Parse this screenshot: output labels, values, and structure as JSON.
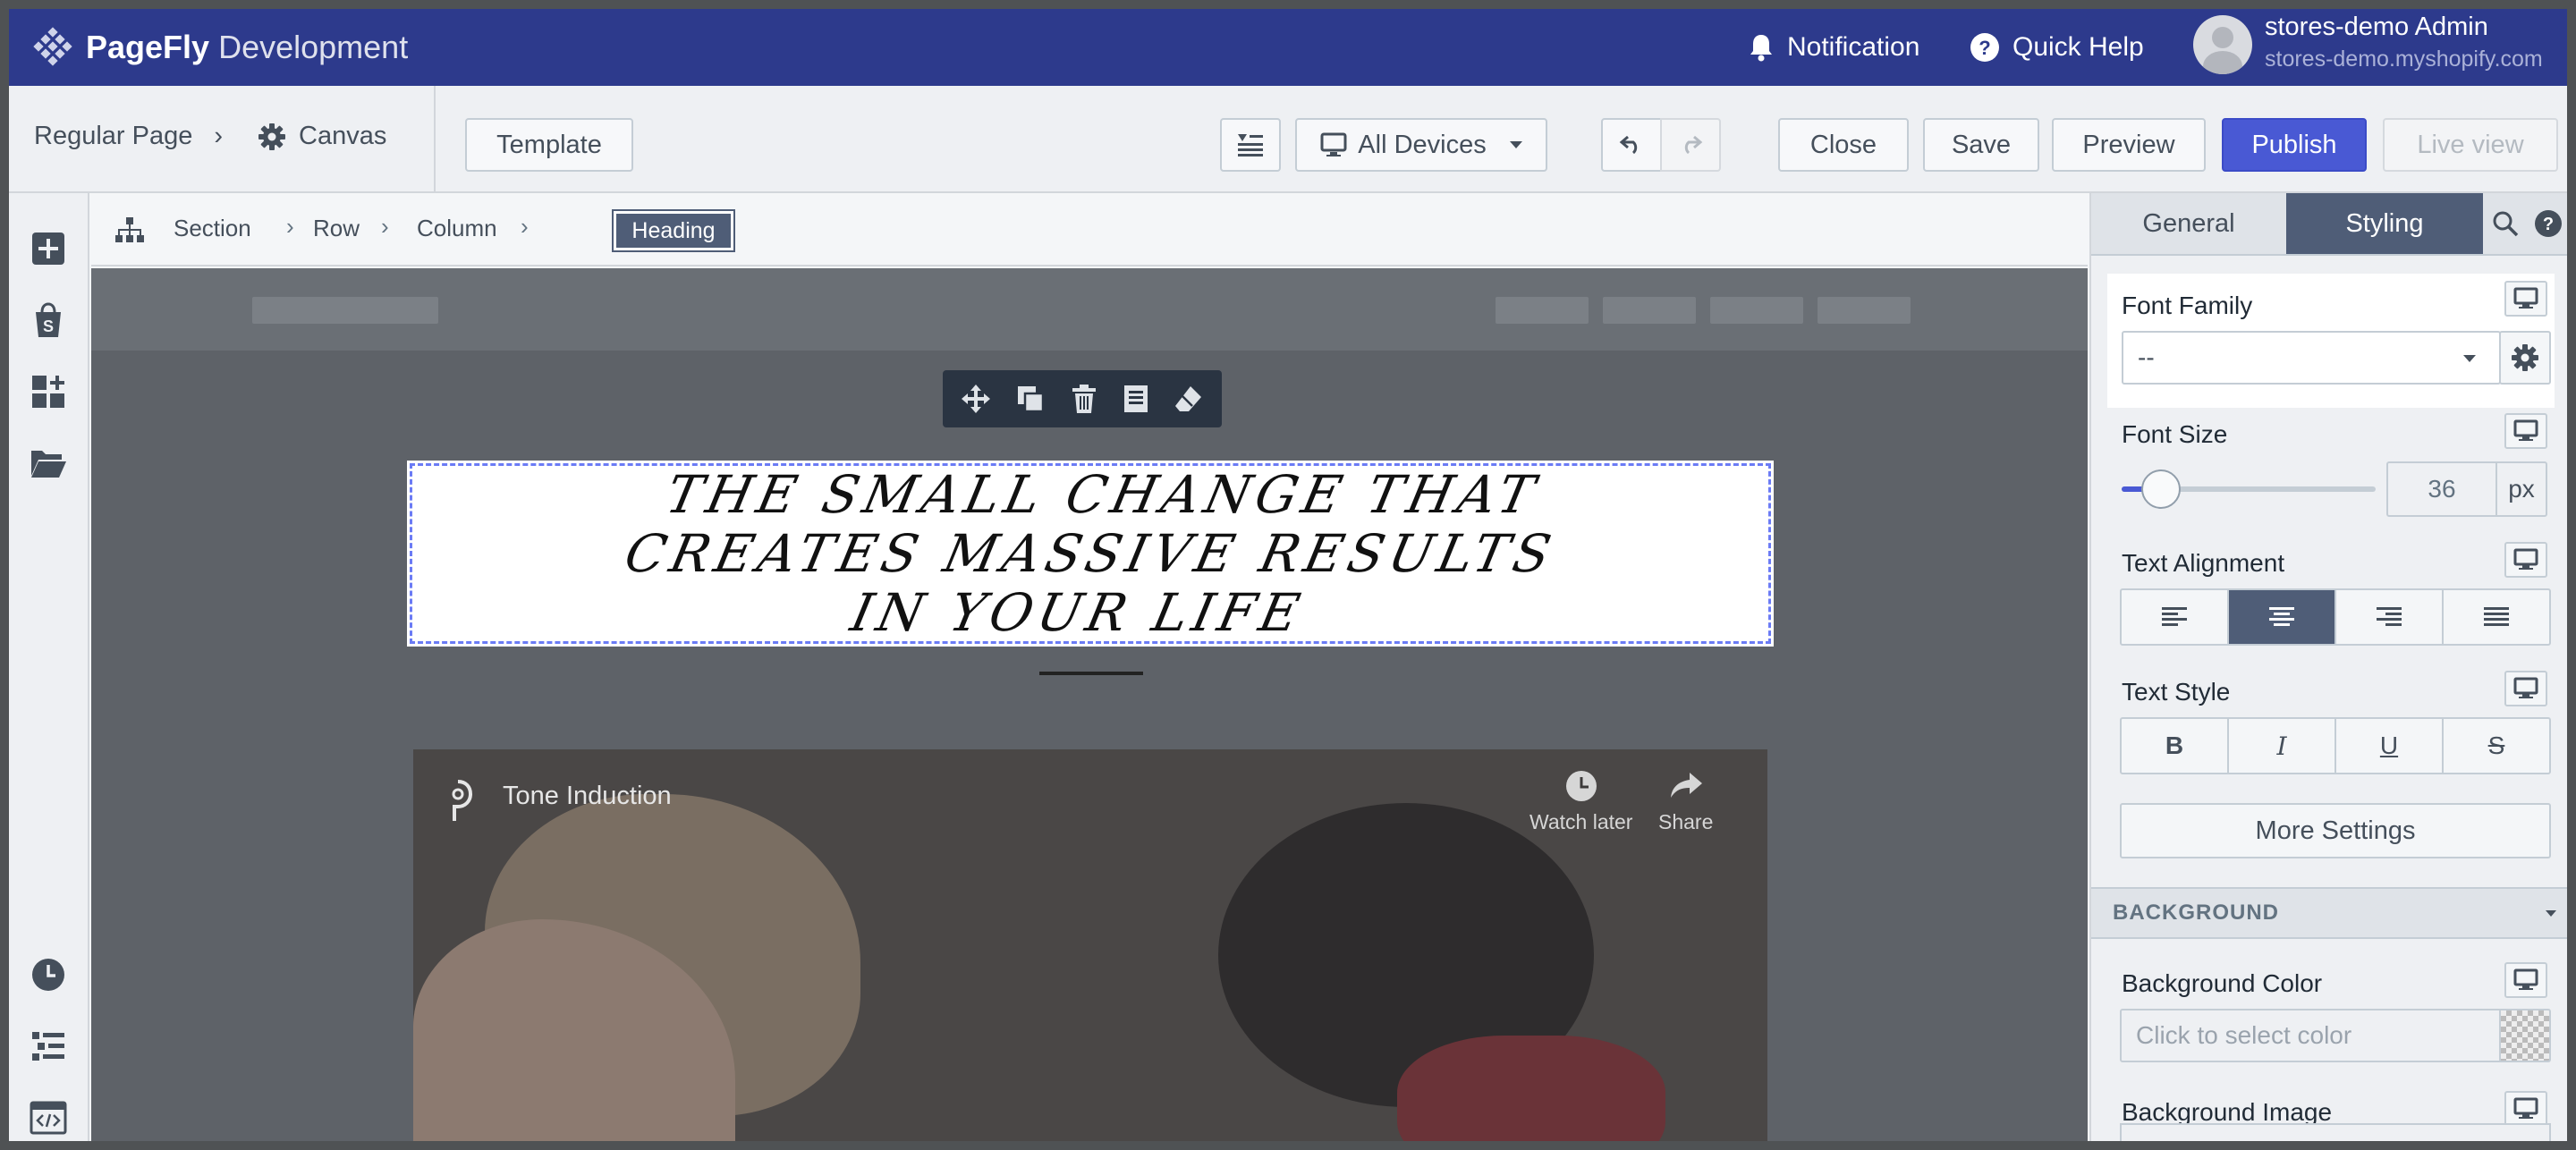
{
  "app": {
    "brand_bold": "PageFly",
    "brand_light": "Development",
    "notification": "Notification",
    "quick_help": "Quick Help",
    "user_name": "stores-demo Admin",
    "user_shop": "stores-demo.myshopify.com"
  },
  "toolbar": {
    "page_type": "Regular Page",
    "canvas": "Canvas",
    "template": "Template",
    "devices": "All Devices",
    "close": "Close",
    "save": "Save",
    "preview": "Preview",
    "publish": "Publish",
    "live_view": "Live view"
  },
  "breadcrumb": {
    "items": [
      "Section",
      "Row",
      "Column"
    ],
    "active": "Heading"
  },
  "canvas": {
    "heading_lines": [
      "THE SMALL CHANGE THAT",
      "CREATES MASSIVE RESULTS",
      "IN YOUR LIFE"
    ],
    "video": {
      "title": "Tone Induction",
      "watch_later": "Watch later",
      "share": "Share"
    }
  },
  "panel": {
    "tabs": [
      "General",
      "Styling"
    ],
    "active_tab": "Styling",
    "font_family": {
      "label": "Font Family",
      "value": "--"
    },
    "font_size": {
      "label": "Font Size",
      "value": "36",
      "unit": "px",
      "slider_fraction": 0.09
    },
    "text_alignment": {
      "label": "Text Alignment",
      "options": [
        "left",
        "center",
        "right",
        "justify"
      ],
      "selected": "center"
    },
    "text_style": {
      "label": "Text Style",
      "options": [
        "B",
        "I",
        "U",
        "S"
      ]
    },
    "more_settings": "More Settings",
    "background": {
      "section": "BACKGROUND",
      "color_label": "Background Color",
      "color_placeholder": "Click to select color",
      "image_label": "Background Image"
    }
  },
  "colors": {
    "topbar": "#2d3a8c",
    "publish": "#4959d4",
    "active_tab": "#4f5d77",
    "selection": "#6b7bf5"
  }
}
